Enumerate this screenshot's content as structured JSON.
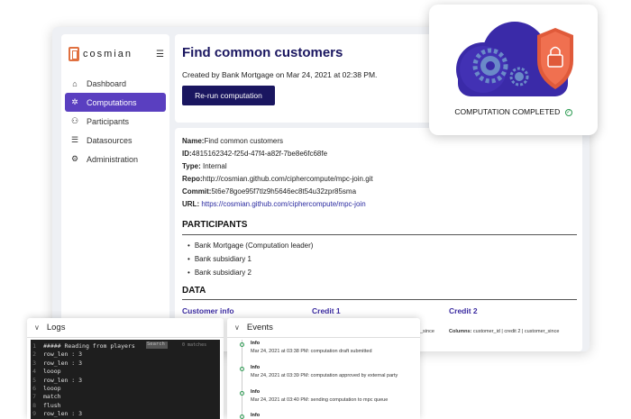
{
  "brand": {
    "name": "cosmian"
  },
  "sidebar": {
    "items": [
      {
        "label": "Dashboard",
        "icon": "home-icon",
        "active": false
      },
      {
        "label": "Computations",
        "icon": "spinner-icon",
        "active": true
      },
      {
        "label": "Participants",
        "icon": "users-icon",
        "active": false
      },
      {
        "label": "Datasources",
        "icon": "database-icon",
        "active": false
      },
      {
        "label": "Administration",
        "icon": "gear-icon",
        "active": false
      }
    ]
  },
  "header": {
    "title": "Find common customers",
    "created": "Created by Bank Mortgage on Mar 24, 2021 at 02:38 PM.",
    "rerun_label": "Re-run computation"
  },
  "details": {
    "name_label": "Name:",
    "name_value": "Find common customers",
    "id_label": "ID:",
    "id_value": "4815162342-f25d-47f4-a82f-7be8e6fc68fe",
    "type_label": "Type:",
    "type_value": " Internal",
    "repo_label": "Repo:",
    "repo_value": "http://cosmian.github.com/ciphercompute/mpc-join.git",
    "commit_label": "Commit:",
    "commit_value": "5t6e78goe95f7tlz9h5646ec8t54u32zpr85sma",
    "url_label": "URL:",
    "url_value": " https://cosmian.github.com/ciphercompute/mpc-join"
  },
  "participants": {
    "title": "PARTICIPANTS",
    "items": [
      "Bank Mortgage (Computation leader)",
      "Bank subsidiary 1",
      "Bank subsidiary 2"
    ]
  },
  "data_section": {
    "title": "DATA",
    "columns": [
      "Customer info",
      "Credit 1",
      "Credit 2"
    ],
    "partial_text": "_since",
    "credit2_columns_label": "Columns:",
    "credit2_columns_value": " customer_id | credit 2 | customer_since"
  },
  "completion": {
    "label": "COMPUTATION COMPLETED",
    "check_glyph": "✓",
    "colors": {
      "cloud": "#3a2aa8",
      "shield": "#e05a3a",
      "gear": "#6a8ac8"
    }
  },
  "logs": {
    "title": "Logs",
    "search_placeholder": "Search",
    "matches": "0 matches",
    "lines": [
      "##### Reading from players",
      "row_len : 3",
      "row_len : 3",
      "looop",
      "row_len : 3",
      "looop",
      "match",
      "flush",
      "row_len : 3"
    ]
  },
  "events": {
    "title": "Events",
    "items": [
      {
        "type": "Info",
        "message": "Mar 24, 2021 at 03:38 PM: computation draft submitted"
      },
      {
        "type": "Info",
        "message": "Mar 24, 2021 at 03:39 PM: computation approved by external party"
      },
      {
        "type": "Info",
        "message": "Mar 24, 2021 at 03:40 PM: sending computation to mpc queue"
      },
      {
        "type": "Info",
        "message": ""
      }
    ]
  }
}
